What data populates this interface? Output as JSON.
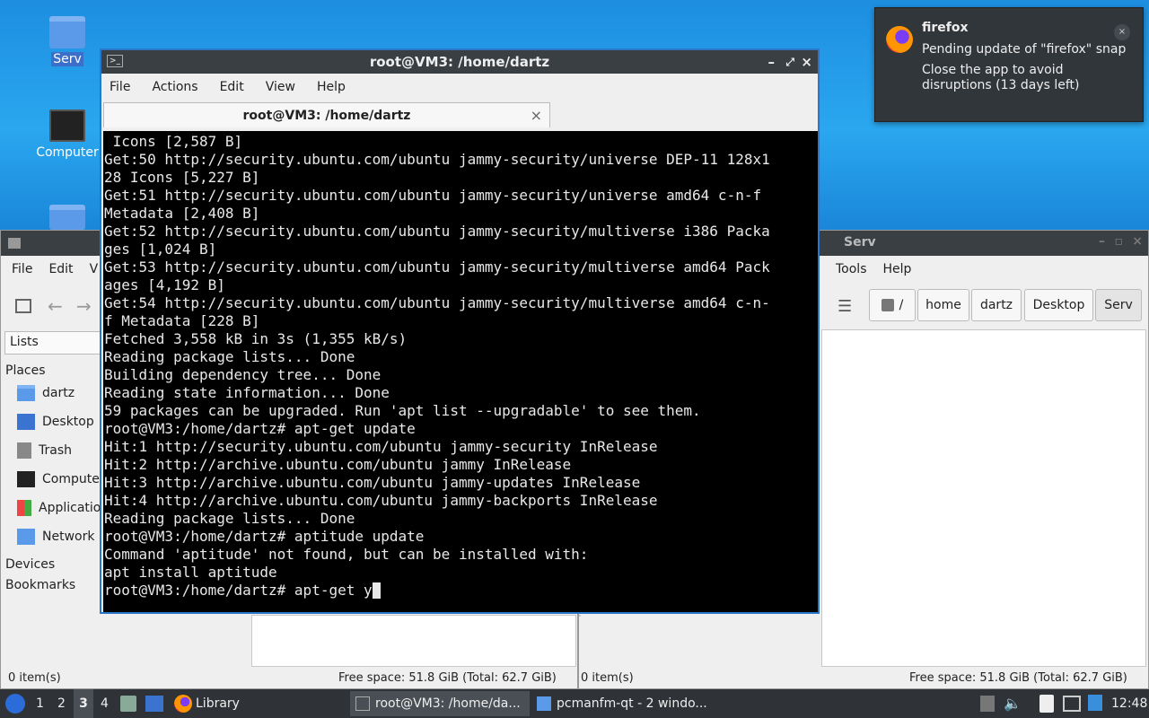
{
  "desktop": {
    "icons": [
      {
        "label": "Serv"
      },
      {
        "label": "Computer"
      }
    ]
  },
  "notification": {
    "app": "firefox",
    "line1": "Pending update of \"firefox\" snap",
    "line2": "Close the app to avoid disruptions (13 days left)",
    "close": "×"
  },
  "fm_left": {
    "menu": [
      "File",
      "Edit",
      "V"
    ],
    "view_mode": "Lists",
    "sections": {
      "places": "Places",
      "devices": "Devices",
      "bookmarks": "Bookmarks"
    },
    "places": [
      "dartz",
      "Desktop",
      "Trash",
      "Compute",
      "Applicatio",
      "Network"
    ],
    "status_items": "0 item(s)",
    "status_free": "Free space: 51.8 GiB (Total: 62.7 GiB)"
  },
  "fm_right": {
    "title": "Serv",
    "menu": [
      "Tools",
      "Help"
    ],
    "path": [
      "/",
      "home",
      "dartz",
      "Desktop",
      "Serv"
    ],
    "status_items": "0 item(s)",
    "status_free": "Free space: 51.8 GiB (Total: 62.7 GiB)"
  },
  "terminal": {
    "title": "root@VM3: /home/dartz",
    "menu": [
      "File",
      "Actions",
      "Edit",
      "View",
      "Help"
    ],
    "tab_title": "root@VM3: /home/dartz",
    "lines": [
      " Icons [2,587 B]",
      "Get:50 http://security.ubuntu.com/ubuntu jammy-security/universe DEP-11 128x1",
      "28 Icons [5,227 B]",
      "Get:51 http://security.ubuntu.com/ubuntu jammy-security/universe amd64 c-n-f",
      "Metadata [2,408 B]",
      "Get:52 http://security.ubuntu.com/ubuntu jammy-security/multiverse i386 Packa",
      "ges [1,024 B]",
      "Get:53 http://security.ubuntu.com/ubuntu jammy-security/multiverse amd64 Pack",
      "ages [4,192 B]",
      "Get:54 http://security.ubuntu.com/ubuntu jammy-security/multiverse amd64 c-n-",
      "f Metadata [228 B]",
      "Fetched 3,558 kB in 3s (1,355 kB/s)",
      "Reading package lists... Done",
      "Building dependency tree... Done",
      "Reading state information... Done",
      "59 packages can be upgraded. Run 'apt list --upgradable' to see them.",
      "root@VM3:/home/dartz# apt-get update",
      "Hit:1 http://security.ubuntu.com/ubuntu jammy-security InRelease",
      "Hit:2 http://archive.ubuntu.com/ubuntu jammy InRelease",
      "Hit:3 http://archive.ubuntu.com/ubuntu jammy-updates InRelease",
      "Hit:4 http://archive.ubuntu.com/ubuntu jammy-backports InRelease",
      "Reading package lists... Done",
      "root@VM3:/home/dartz# aptitude update",
      "Command 'aptitude' not found, but can be installed with:",
      "apt install aptitude"
    ],
    "prompt_line": "root@VM3:/home/dartz# apt-get y"
  },
  "taskbar": {
    "workspaces": [
      "1",
      "2",
      "3",
      "4"
    ],
    "active_workspace": "3",
    "library": "Library",
    "tasks": [
      "root@VM3: /home/da...",
      "pcmanfm-qt - 2 windo..."
    ],
    "clock": "12:48"
  }
}
